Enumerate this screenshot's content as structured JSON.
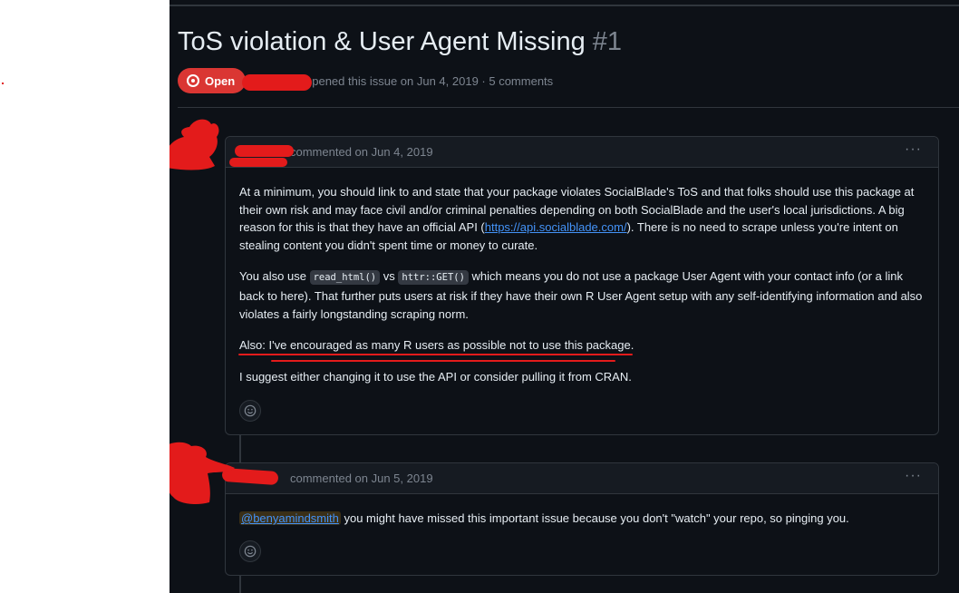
{
  "issue": {
    "title": "ToS violation & User Agent Missing",
    "number": "#1",
    "status": "Open",
    "meta": "opened this issue on Jun 4, 2019 · 5 comments"
  },
  "comments": [
    {
      "meta": "commented on Jun 4, 2019",
      "menu_label": "···",
      "p1_a": "At a minimum, you should link to and state that your package violates SocialBlade's ToS and that folks should use this package at their own risk and may face civil and/or criminal penalties depending on both SocialBlade and the user's local jurisdictions. A big reason for this is that they have an official API (",
      "p1_link": "https://api.socialblade.com/",
      "p1_b": "). There is no need to scrape unless you're intent on stealing content you didn't spent time or money to curate.",
      "p2_a": "You also use ",
      "p2_code1": "read_html()",
      "p2_b": " vs ",
      "p2_code2": "httr::GET()",
      "p2_c": " which means you do not use a package User Agent with your contact info (or a link back to here). That further puts users at risk if they have their own R User Agent setup with any self-identifying information and also violates a fairly longstanding scraping norm.",
      "p3": "Also: I've encouraged as many R users as possible not to use this package.",
      "p4": "I suggest either changing it to use the API or consider pulling it from CRAN."
    },
    {
      "meta": "commented on Jun 5, 2019",
      "menu_label": "···",
      "mention": "@benyamindsmith",
      "text": " you might have missed this important issue because you don't \"watch\" your repo, so pinging you."
    }
  ],
  "colors": {
    "background": "#0d1117",
    "status_open": "#da3633",
    "link": "#4493f8",
    "mention": "#e3b341",
    "redaction": "#e31b1b"
  },
  "icons": [
    "issue-opened-icon",
    "kebab-menu-icon",
    "smiley-icon"
  ]
}
